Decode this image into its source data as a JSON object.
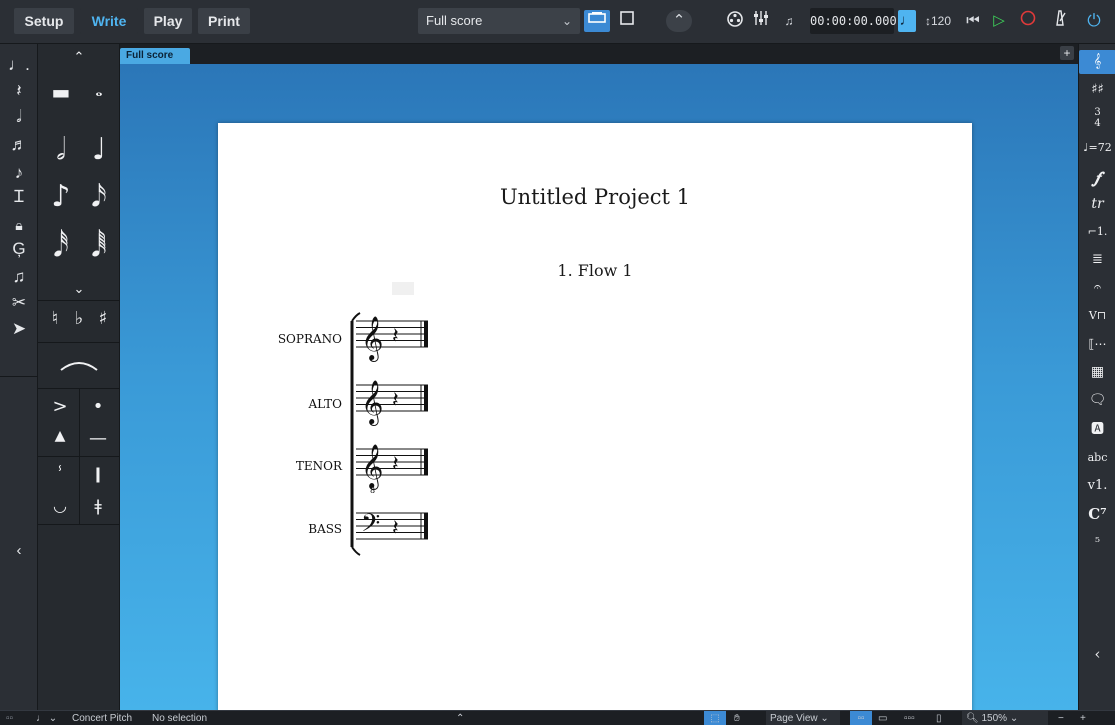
{
  "modes": [
    "Setup",
    "Write",
    "Play",
    "Print"
  ],
  "active_mode": "Write",
  "layout_select": {
    "value": "Full score"
  },
  "transport": {
    "time": "00:00:00.000",
    "tempo": "120"
  },
  "left_toolbox": [
    "note-input",
    "rest",
    "slash",
    "tuplet",
    "grace-note",
    "insert",
    "lock-duration",
    "force-duration",
    "chord",
    "scissors",
    "select"
  ],
  "notes_panel": {
    "up_chevron": "⌃",
    "down_chevron": "⌄",
    "accidentals": [
      "♮",
      "♭",
      "♯"
    ],
    "collapse": "‹"
  },
  "tab": {
    "label": "Full score"
  },
  "score": {
    "project_title": "Untitled Project 1",
    "flow_title": "1. Flow 1",
    "instruments": [
      "SOPRANO",
      "ALTO",
      "TENOR",
      "BASS"
    ]
  },
  "right_panel": {
    "items": [
      "clef-icon",
      "key-signature-icon",
      "time-signature-icon",
      "tempo-icon",
      "dynamics-icon",
      "ornaments-icon",
      "repeat-endings-icon",
      "bars-icon",
      "holds-pauses-icon",
      "playing-techniques-icon",
      "lines-icon",
      "cues-icon",
      "comments-icon",
      "text-icon",
      "lyrics-icon",
      "versions-icon",
      "chord-symbols-icon",
      "figured-bass-icon"
    ],
    "rp_text": "abc",
    "rp_v1": "v1.",
    "rp_c7": "C⁷",
    "rp_fig": "⁵",
    "collapse": "‹"
  },
  "statusbar": {
    "concert_pitch": "Concert Pitch",
    "selection": "No selection",
    "view": "Page View",
    "zoom": "150%"
  },
  "colors": {
    "accent": "#4fb4f0",
    "background_top": "#2a74b6",
    "background_bottom": "#47b3ea"
  }
}
